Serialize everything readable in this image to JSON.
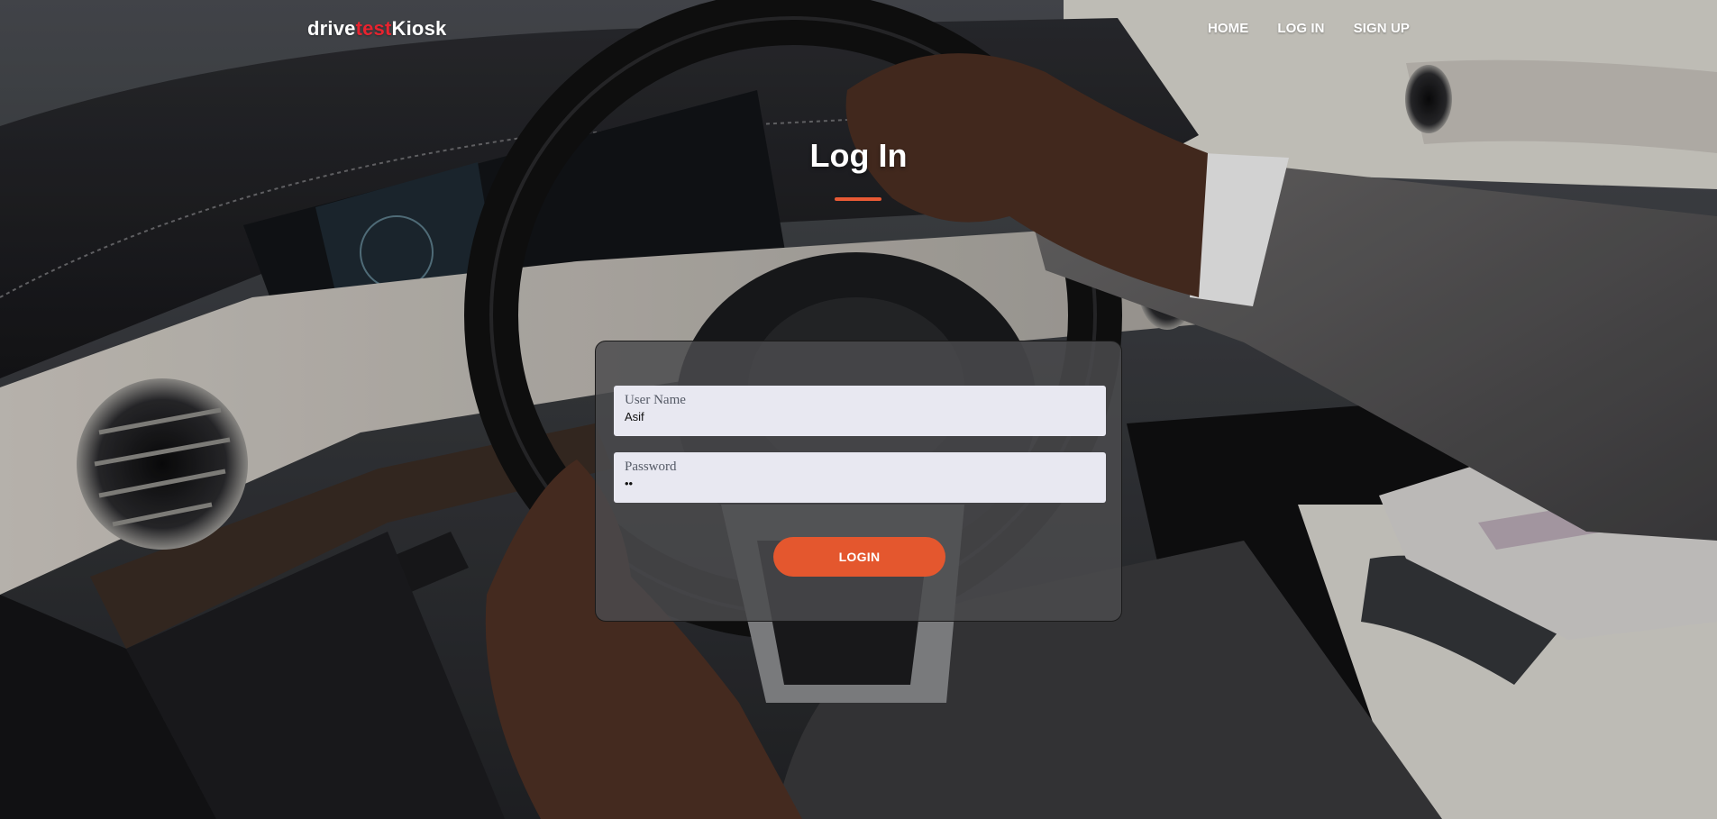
{
  "brand": {
    "part1": "drive",
    "part2": "test",
    "part3": "Kiosk"
  },
  "nav": {
    "home": "HOME",
    "login": "LOG IN",
    "signup": "SIGN UP"
  },
  "page_title": "Log In",
  "form": {
    "username_label": "User Name",
    "username_value": "Asif",
    "password_label": "Password",
    "password_value": "••",
    "submit_label": "LOGIN"
  },
  "colors": {
    "accent": "#e4572e",
    "brand_red": "#e8232f"
  }
}
